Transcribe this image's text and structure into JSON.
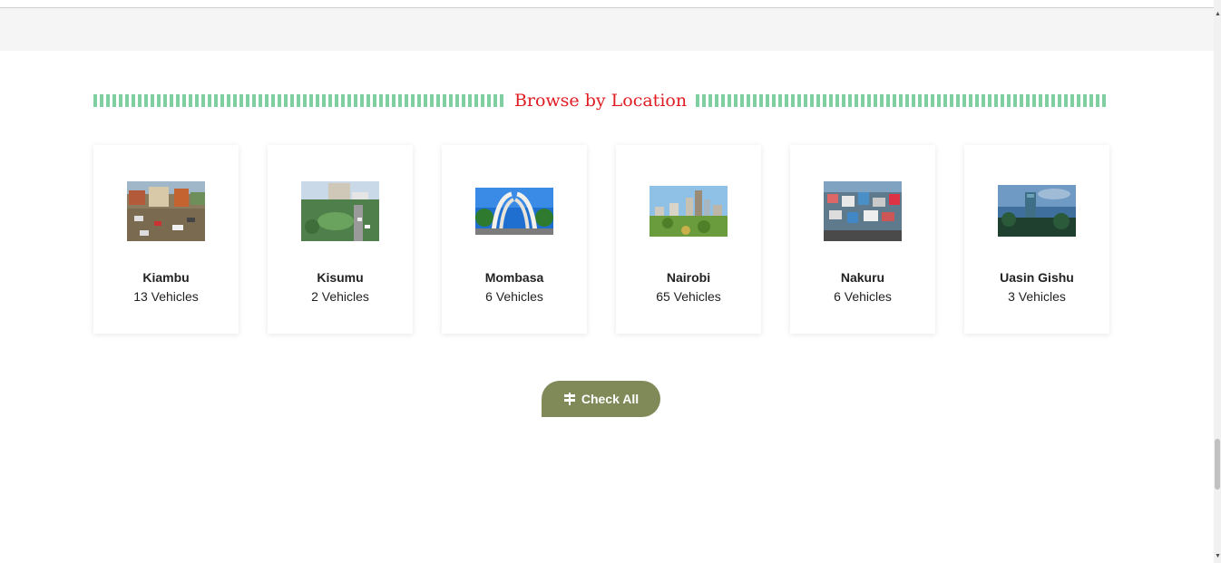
{
  "section": {
    "title": "Browse by Location"
  },
  "locations": [
    {
      "name": "Kiambu",
      "count": "13 Vehicles"
    },
    {
      "name": "Kisumu",
      "count": "2 Vehicles"
    },
    {
      "name": "Mombasa",
      "count": "6 Vehicles"
    },
    {
      "name": "Nairobi",
      "count": "65 Vehicles"
    },
    {
      "name": "Nakuru",
      "count": "6 Vehicles"
    },
    {
      "name": "Uasin Gishu",
      "count": "3 Vehicles"
    }
  ],
  "check_all": {
    "label": "Check All",
    "icon": "signpost-icon"
  },
  "colors": {
    "heading": "#e01b22",
    "dashes": "#7fcfa0",
    "button": "#7f8a58"
  }
}
